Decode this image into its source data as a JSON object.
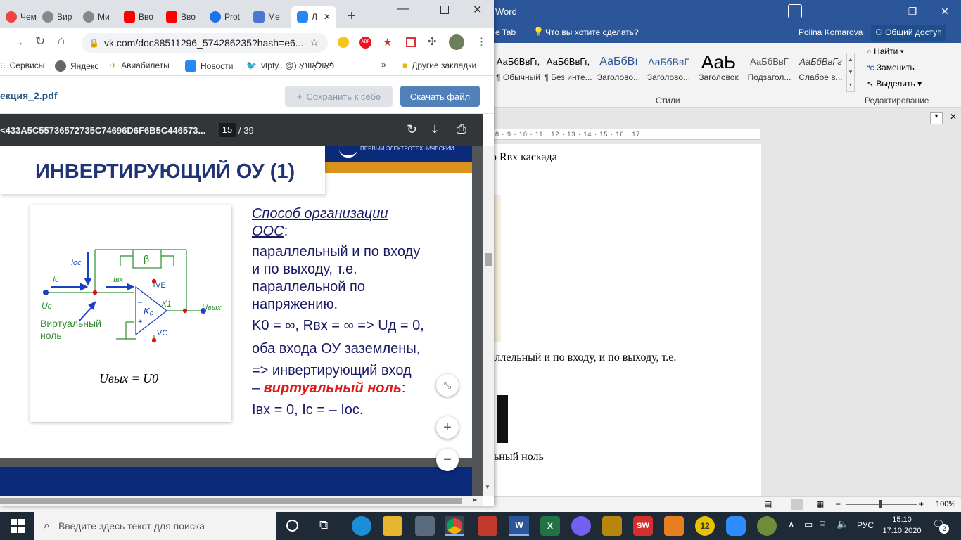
{
  "word": {
    "title": "Word",
    "tabs_tail": "e Tab",
    "tell_me": "Что вы хотите сделать?",
    "user": "Polina Komarova",
    "share": "Общий доступ",
    "styles": [
      {
        "sample": "АаБбВвГг,",
        "name": "¶ Обычный"
      },
      {
        "sample": "АаБбВвГг,",
        "name": "¶ Без инте..."
      },
      {
        "sample": "АаБбВı",
        "name": "Заголово..."
      },
      {
        "sample": "АаБбВвГ",
        "name": "Заголово..."
      },
      {
        "sample": "АаЬ",
        "name": "Заголовок"
      },
      {
        "sample": "АаБбВвГ",
        "name": "Подзагол..."
      },
      {
        "sample": "АаБбВвГг",
        "name": "Слабое в..."
      }
    ],
    "group_styles": "Стили",
    "find": "Найти",
    "replace": "Заменить",
    "select": "Выделить",
    "group_edit": "Редактирование",
    "ruler": "8 · 9 · 10 · 11 · 12 · 13 · 14 · 15 · 16 · 17",
    "doc_lines": [
      "ю Rвх каскада",
      "аллельный и по входу, и по выходу, т.е.",
      "льный ноль"
    ],
    "zoom": "100%"
  },
  "chrome": {
    "tabs": [
      "Чем",
      "Вир",
      "Ми",
      "Вво",
      "Вво",
      "Prot",
      "Ме",
      "Л"
    ],
    "url": "vk.com/doc88511296_574286235?hash=e6...",
    "bookmarks": [
      "Сервисы",
      "Яндекс",
      "Авиабилеты",
      "Новости",
      "vtpfy...@)  פֿאַוּלאָווּנאַ",
      "Другие закладки"
    ]
  },
  "vk": {
    "filename": "екция_2.pdf",
    "save": "Сохранить к себе",
    "download": "Скачать файл"
  },
  "pdf": {
    "doc_id": "<433A5C55736572735C74696D6F6B5C446573...",
    "page": "15",
    "total": "/ 39"
  },
  "slide": {
    "title": "ИНВЕРТИРУЮЩИЙ ОУ (1)",
    "logo_text": "ПЕРВЫЙ ЭЛЕКТРОТЕХНИЧЕСКИЙ",
    "circuit": {
      "ioc": "Iос",
      "ic": "Iс",
      "ivx": "Iвх",
      "beta": "β",
      "ve": "VE",
      "x1": "X1",
      "k0": "K₀",
      "vc": "VC",
      "uc": "Uс",
      "uvyh": "Uвых",
      "minus": "–",
      "plus": "+",
      "virtual1": "Виртуальный",
      "virtual2": "ноль",
      "formula": "Uвых = U0"
    },
    "method1": "Способ организации",
    "method2": "ООС",
    "body": [
      "параллельный и по входу",
      "и по выходу, т.е.",
      "параллельной по",
      "напряжению."
    ],
    "line_k": "K0 = ∞, Rвх = ∞ => Uд = 0,",
    "line_ground": "оба входа ОУ заземлены,",
    "line_inv": "=> инвертирующий вход",
    "line_virt_pre": "– ",
    "line_virt": "виртуальный ноль",
    "line_virt_post": ":",
    "line_i": "Iвх = 0, Iс = – Iос."
  },
  "taskbar": {
    "search": "Введите здесь текст для поиска",
    "lang": "РУС",
    "time": "15:10",
    "date": "17.10.2020",
    "notif": "2"
  }
}
